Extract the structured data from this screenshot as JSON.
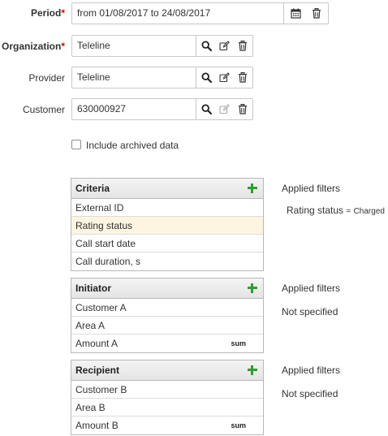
{
  "period": {
    "label": "Period",
    "required_mark": "*",
    "value": "from 01/08/2017 to 24/08/2017"
  },
  "organization": {
    "label": "Organization",
    "required_mark": "*",
    "value": "Teleline"
  },
  "provider": {
    "label": "Provider",
    "value": "Teleline"
  },
  "customer": {
    "label": "Customer",
    "value": "630000927"
  },
  "include_archived": {
    "label": "Include archived data",
    "checked": false
  },
  "criteria": {
    "title": "Criteria",
    "items": [
      "External ID",
      "Rating status",
      "Call start date",
      "Call duration, s"
    ],
    "highlighted_index": 1,
    "applied_filters_label": "Applied filters",
    "filter": {
      "name": "Rating status",
      "operator": "=",
      "value": "Charged"
    }
  },
  "initiator": {
    "title": "Initiator",
    "items": [
      "Customer A",
      "Area A",
      "Amount A"
    ],
    "amount_tag": "sum",
    "applied_filters_label": "Applied filters",
    "filters_text": "Not specified"
  },
  "recipient": {
    "title": "Recipient",
    "items": [
      "Customer B",
      "Area B",
      "Amount B"
    ],
    "amount_tag": "sum",
    "applied_filters_label": "Applied filters",
    "filters_text": "Not specified"
  },
  "colors": {
    "required": "#d00000",
    "add_icon": "#2f9e2f",
    "highlight_row": "#fdf5e2"
  },
  "icons": [
    "calendar-icon",
    "trash-icon",
    "search-icon",
    "edit-icon",
    "plus-icon"
  ]
}
